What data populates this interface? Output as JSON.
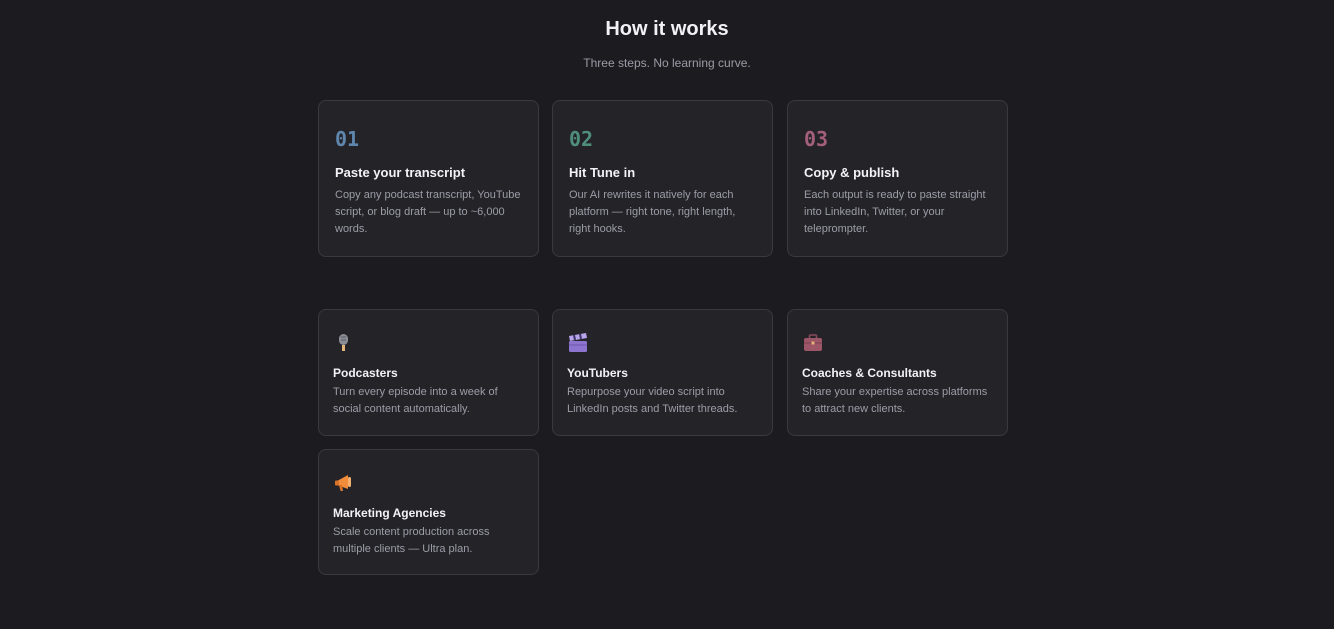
{
  "section": {
    "title": "How it works",
    "subtitle": "Three steps. No learning curve."
  },
  "steps": [
    {
      "number": "01",
      "title": "Paste your transcript",
      "description": "Copy any podcast transcript, YouTube script, or blog draft — up to ~6,000 words.",
      "color": "#5f86ad"
    },
    {
      "number": "02",
      "title": "Hit Tune in",
      "description": "Our AI rewrites it natively for each platform — right tone, right length, right hooks.",
      "color": "#4f8f7a"
    },
    {
      "number": "03",
      "title": "Copy & publish",
      "description": "Each output is ready to paste straight into LinkedIn, Twitter, or your teleprompter.",
      "color": "#a45f7c"
    }
  ],
  "audiences": [
    {
      "icon": "microphone-icon",
      "title": "Podcasters",
      "description": "Turn every episode into a week of social content automatically."
    },
    {
      "icon": "clapperboard-icon",
      "title": "YouTubers",
      "description": "Repurpose your video script into LinkedIn posts and Twitter threads."
    },
    {
      "icon": "briefcase-icon",
      "title": "Coaches & Consultants",
      "description": "Share your expertise across platforms to attract new clients."
    },
    {
      "icon": "megaphone-icon",
      "title": "Marketing Agencies",
      "description": "Scale content production across multiple clients — Ultra plan."
    }
  ]
}
